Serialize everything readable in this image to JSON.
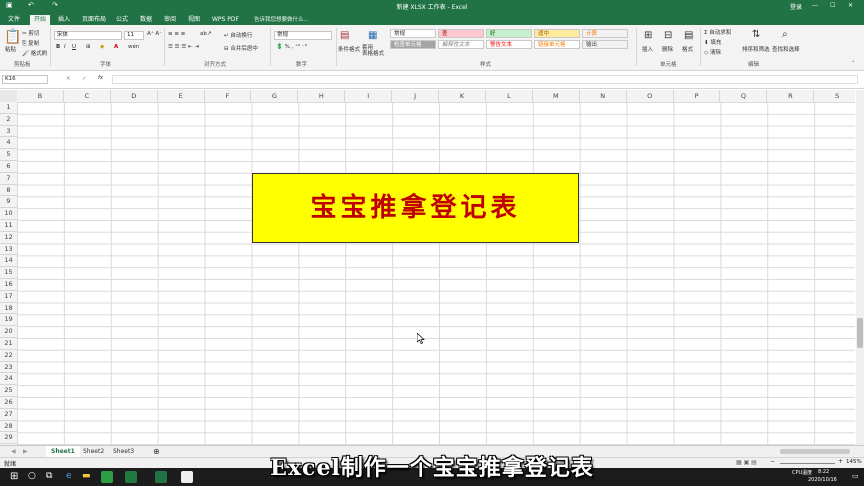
{
  "titlebar": {
    "title": "新建 XLSX 工作表 - Excel",
    "login": "登录"
  },
  "tabs": [
    "文件",
    "开始",
    "插入",
    "页面布局",
    "公式",
    "数据",
    "审阅",
    "视图",
    "WPS PDF"
  ],
  "tellme": "告诉我您想要做什么...",
  "ribbon": {
    "clipboard": {
      "paste": "粘贴",
      "cut": "剪切",
      "copy": "复制",
      "format_painter": "格式刷",
      "label": "剪贴板"
    },
    "font": {
      "name": "宋体",
      "size": "11",
      "label": "字体"
    },
    "alignment": {
      "wrap": "自动换行",
      "merge": "合并后居中",
      "label": "对齐方式"
    },
    "number": {
      "format": "常规",
      "label": "数字"
    },
    "styles": {
      "cond": "条件格式",
      "table": "套用\n表格格式",
      "label": "样式",
      "cells": [
        "常规",
        "差",
        "好",
        "适中",
        "计算",
        "检查单元格",
        "解释性文本",
        "警告文本",
        "链接单元格",
        "输出"
      ]
    },
    "cells": {
      "insert": "插入",
      "delete": "删除",
      "format": "格式",
      "label": "单元格"
    },
    "editing": {
      "autosum": "自动求和",
      "fill": "填充",
      "clear": "清除",
      "sort": "排序和筛选",
      "find": "查找和选择",
      "label": "编辑"
    }
  },
  "formula": {
    "namebox": "K16",
    "fx": "fx",
    "value": ""
  },
  "columns": [
    "B",
    "C",
    "D",
    "E",
    "F",
    "G",
    "H",
    "I",
    "J",
    "K",
    "L",
    "M",
    "N",
    "O",
    "P",
    "Q",
    "R",
    "S"
  ],
  "rows": [
    "1",
    "2",
    "3",
    "4",
    "5",
    "6",
    "7",
    "8",
    "9",
    "10",
    "11",
    "12",
    "13",
    "14",
    "15",
    "16",
    "17",
    "18",
    "19",
    "20",
    "21",
    "22",
    "23",
    "24",
    "25",
    "26",
    "27",
    "28",
    "29"
  ],
  "titlebox": {
    "text": "宝宝推拿登记表"
  },
  "sheets": [
    "Sheet1",
    "Sheet2",
    "Sheet3"
  ],
  "status": {
    "ready": "就绪",
    "zoom": "145%"
  },
  "taskbar": {
    "cpu": "CPU温度",
    "time": "8:22",
    "date": "2020/10/16"
  },
  "caption": "Excel制作一个宝宝推拿登记表"
}
